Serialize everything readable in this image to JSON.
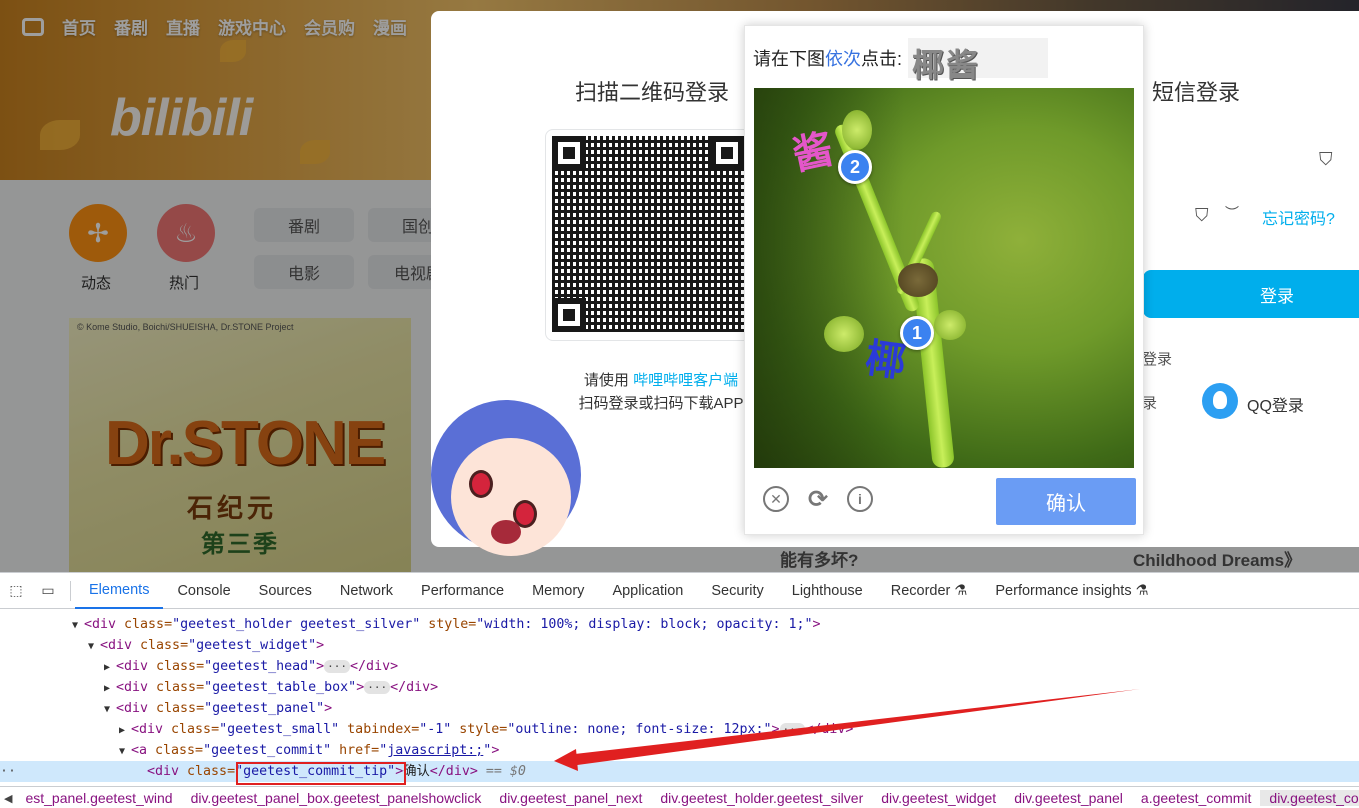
{
  "bili": {
    "nav": [
      "首页",
      "番剧",
      "直播",
      "游戏中心",
      "会员购",
      "漫画"
    ],
    "logo": "bilibili",
    "quick": [
      {
        "label": "动态",
        "icon": "pinwheel-icon"
      },
      {
        "label": "热门",
        "icon": "flame-icon"
      }
    ],
    "categories": [
      "番剧",
      "国创",
      "电影",
      "电视剧"
    ],
    "poster": {
      "copyright": "© Kome Studio, Boichi/SHUEISHA, Dr.STONE Project",
      "title": "Dr.STONE",
      "subtitle": "石纪元",
      "season": "第三季"
    },
    "login": {
      "qr_title": "扫描二维码登录",
      "sms_title": "短信登录",
      "qr_hint_prefix": "请使用",
      "qr_hint_link": "哔哩哔哩客户端",
      "qr_hint_suffix": "扫码登录或扫码下载APP",
      "forgot": "忘记密码?",
      "login_button": "登录",
      "other_login": "登录",
      "other_login2": "录",
      "qq_login": "QQ登录"
    },
    "bottom_left": "能有多坏?",
    "bottom_right": "Childhood Dreams》"
  },
  "geetest": {
    "prompt_prefix": "请在下图",
    "prompt_highlight": "依次",
    "prompt_suffix": "点击:",
    "target_chars": [
      "椰",
      "酱"
    ],
    "markers": [
      "1",
      "2"
    ],
    "confirm_label": "确认",
    "colors": {
      "marker": "#3b82f0",
      "confirm": "#6a9cf4",
      "highlight": "#3873e0"
    }
  },
  "devtools": {
    "tabs": [
      "Elements",
      "Console",
      "Sources",
      "Network",
      "Performance",
      "Memory",
      "Application",
      "Security",
      "Lighthouse",
      "Recorder",
      "Performance insights"
    ],
    "active_tab": "Elements",
    "dom": {
      "l1_tag_open": "<div",
      "l1_attr1": " class=",
      "l1_val1": "\"geetest_holder geetest_silver\"",
      "l1_attr2": " style=",
      "l1_val2": "\"width: 100%; display: block; opacity: 1;\"",
      "l1_close": ">",
      "l2_class": "\"geetest_widget\"",
      "l3_class": "\"geetest_head\"",
      "l4_class": "\"geetest_table_box\"",
      "l5_class": "\"geetest_panel\"",
      "l6_class": "\"geetest_small\"",
      "l6_tabindex": "\"-1\"",
      "l6_style": "\"outline: none; font-size: 12px;\"",
      "l7_class": "\"geetest_commit\"",
      "l7_href": "javascript:;",
      "l8_class": "\"geetest_commit_tip\"",
      "l8_text": "确认",
      "l8_comment": "== $0"
    },
    "breadcrumbs": [
      "est_panel.geetest_wind",
      "div.geetest_panel_box.geetest_panelshowclick",
      "div.geetest_panel_next",
      "div.geetest_holder.geetest_silver",
      "div.geetest_widget",
      "div.geetest_panel",
      "a.geetest_commit",
      "div.geetest_commit_tip"
    ]
  }
}
